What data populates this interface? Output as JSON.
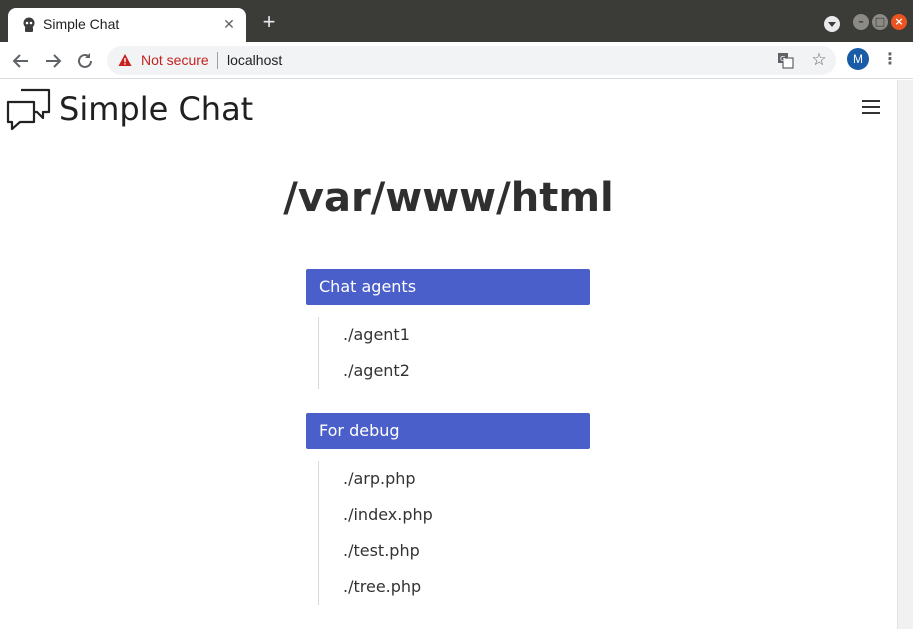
{
  "browser": {
    "tab_title": "Simple Chat",
    "tab_close_glyph": "✕",
    "new_tab_glyph": "+",
    "security_label": "Not secure",
    "url": "localhost",
    "avatar_letter": "M",
    "icons": [
      "tab-favicon-icon",
      "close-icon",
      "plus-icon",
      "back-arrow-icon",
      "forward-arrow-icon",
      "reload-icon",
      "warning-icon",
      "translate-icon",
      "star-icon",
      "kebab-menu-icon"
    ],
    "colors": {
      "security_warning": "#c5221f",
      "avatar_bg": "#1a5ba8",
      "tabstrip_bg": "#3b3b38"
    }
  },
  "header": {
    "brand": "Simple Chat",
    "icons": [
      "chat-bubbles-logo-icon",
      "hamburger-menu-icon"
    ]
  },
  "main": {
    "title": "/var/www/html",
    "sections": [
      {
        "heading": "Chat agents",
        "items": [
          "./agent1",
          "./agent2"
        ]
      },
      {
        "heading": "For debug",
        "items": [
          "./arp.php",
          "./index.php",
          "./test.php",
          "./tree.php"
        ]
      }
    ],
    "colors": {
      "section_heading_bg": "#4a5fc9"
    }
  }
}
